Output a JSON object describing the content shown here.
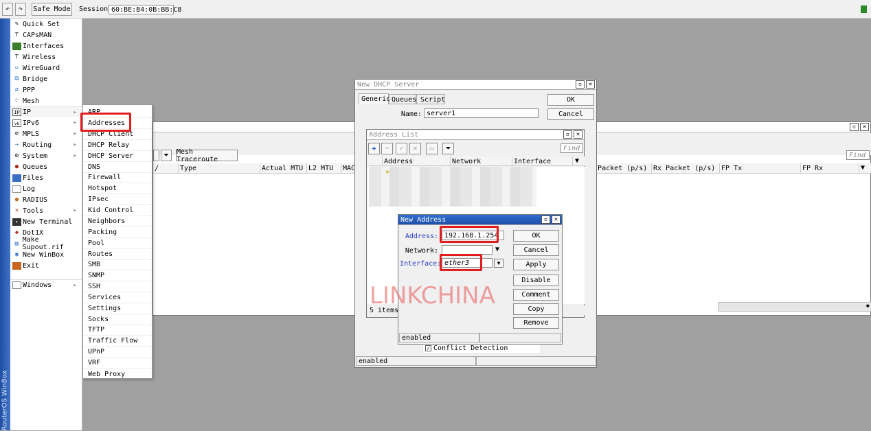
{
  "toolbar": {
    "undo_icon": "undo-icon",
    "redo_icon": "redo-icon",
    "safe_mode": "Safe Mode",
    "session_label": "Session:",
    "session_value": "60:BE:B4:0B:BB:C8",
    "status_color": "#2a8a2a"
  },
  "brand_strip": "RouterOS WinBox",
  "main_menu": [
    {
      "label": "Quick Set",
      "icon": "wand-icon"
    },
    {
      "label": "CAPsMAN",
      "icon": "antenna-icon"
    },
    {
      "label": "Interfaces",
      "icon": "interfaces-icon"
    },
    {
      "label": "Wireless",
      "icon": "wireless-icon"
    },
    {
      "label": "WireGuard",
      "icon": "wireguard-icon"
    },
    {
      "label": "Bridge",
      "icon": "bridge-icon"
    },
    {
      "label": "PPP",
      "icon": "ppp-icon"
    },
    {
      "label": "Mesh",
      "icon": "mesh-icon"
    },
    {
      "label": "IP",
      "icon": "ip-icon",
      "arrow": "▸"
    },
    {
      "label": "IPv6",
      "icon": "ipv6-icon",
      "arrow": "▸"
    },
    {
      "label": "MPLS",
      "icon": "mpls-icon",
      "arrow": "▸"
    },
    {
      "label": "Routing",
      "icon": "routing-icon",
      "arrow": "▸"
    },
    {
      "label": "System",
      "icon": "system-icon",
      "arrow": "▸"
    },
    {
      "label": "Queues",
      "icon": "queues-icon"
    },
    {
      "label": "Files",
      "icon": "files-icon"
    },
    {
      "label": "Log",
      "icon": "log-icon"
    },
    {
      "label": "RADIUS",
      "icon": "radius-icon"
    },
    {
      "label": "Tools",
      "icon": "tools-icon",
      "arrow": "▸"
    },
    {
      "label": "New Terminal",
      "icon": "terminal-icon"
    },
    {
      "label": "Dot1X",
      "icon": "dot1x-icon"
    },
    {
      "label": "Make Supout.rif",
      "icon": "supout-icon"
    },
    {
      "label": "New WinBox",
      "icon": "winbox-icon"
    },
    {
      "label": "Exit",
      "icon": "exit-icon"
    },
    {
      "label": "Windows",
      "icon": "windows-icon",
      "arrow": "▸"
    }
  ],
  "ip_submenu": [
    "ARP",
    "Addresses",
    "DHCP Client",
    "DHCP Relay",
    "DHCP Server",
    "DNS",
    "Firewall",
    "Hotspot",
    "IPsec",
    "Kid Control",
    "Neighbors",
    "Packing",
    "Pool",
    "Routes",
    "SMB",
    "SNMP",
    "SSH",
    "Services",
    "Settings",
    "Socks",
    "TFTP",
    "Traffic Flow",
    "UPnP",
    "VRF",
    "Web Proxy"
  ],
  "dhcp_window": {
    "title": "New DHCP Server",
    "tabs": [
      "Generic",
      "Queues",
      "Script"
    ],
    "name_label": "Name:",
    "name_value": "server1",
    "ok": "OK",
    "cancel": "Cancel",
    "conflict_label": "Conflict Detection",
    "status": "enabled"
  },
  "interface_window": {
    "mesh_traceroute": "Mesh Traceroute",
    "find": "Find",
    "columns": [
      "Type",
      "Actual MTU",
      "L2 MTU",
      "MAC Ad",
      "Tx Packet (p/s)",
      "Rx Packet (p/s)",
      "FP Tx",
      "FP Rx"
    ]
  },
  "address_list": {
    "title": "Address List",
    "find": "Find",
    "columns": [
      "Address",
      "Network",
      "Interface"
    ],
    "count": "5 items"
  },
  "new_address": {
    "title": "New Address",
    "address_label": "Address:",
    "address_value": "192.168.1.254",
    "network_label": "Network:",
    "network_value": "",
    "interface_label": "Interface:",
    "interface_value": "ether3",
    "buttons": [
      "OK",
      "Cancel",
      "Apply",
      "Disable",
      "Comment",
      "Copy",
      "Remove"
    ],
    "status": "enabled"
  },
  "watermark": "LINKCHINA",
  "highlight_color": "#e21d1d"
}
